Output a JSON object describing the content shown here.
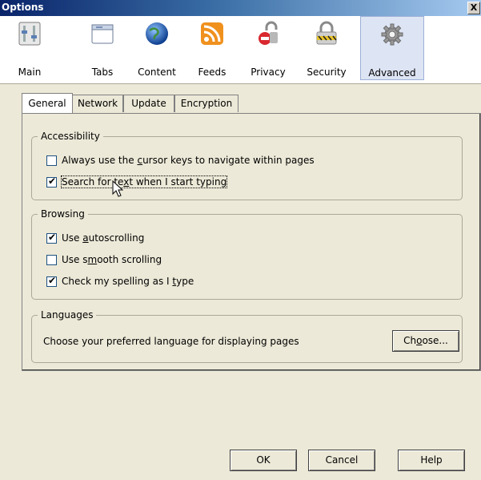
{
  "window": {
    "title": "Options",
    "close_label": "X"
  },
  "toolbar": {
    "items": [
      {
        "label": "Main",
        "icon": "main-settings-icon"
      },
      {
        "label": "Tabs",
        "icon": "tabs-icon"
      },
      {
        "label": "Content",
        "icon": "globe-icon"
      },
      {
        "label": "Feeds",
        "icon": "rss-feed-icon"
      },
      {
        "label": "Privacy",
        "icon": "privacy-lock-icon"
      },
      {
        "label": "Security",
        "icon": "security-padlock-icon"
      },
      {
        "label": "Advanced",
        "icon": "gear-icon"
      }
    ],
    "selected": "Advanced"
  },
  "subtabs": [
    "General",
    "Network",
    "Update",
    "Encryption"
  ],
  "active_subtab": "General",
  "accessibility": {
    "legend": "Accessibility",
    "cursor_keys": {
      "pre": "Always use the ",
      "u": "c",
      "post": "ursor keys to navigate within pages",
      "checked": false
    },
    "search_text": {
      "pre": "Search for te",
      "u": "x",
      "post": "t when I start typing",
      "checked": true
    }
  },
  "browsing": {
    "legend": "Browsing",
    "autoscroll": {
      "pre": "Use ",
      "u": "a",
      "post": "utoscrolling",
      "checked": true
    },
    "smooth": {
      "pre": "Use s",
      "u": "m",
      "post": "ooth scrolling",
      "checked": false
    },
    "spelling": {
      "pre": "Check my spelling as I ",
      "u": "t",
      "post": "ype",
      "checked": true
    }
  },
  "languages": {
    "legend": "Languages",
    "description": "Choose your preferred language for displaying pages",
    "choose": {
      "pre": "Ch",
      "u": "o",
      "post": "ose..."
    }
  },
  "footer": {
    "ok": "OK",
    "cancel": "Cancel",
    "help": "Help"
  }
}
